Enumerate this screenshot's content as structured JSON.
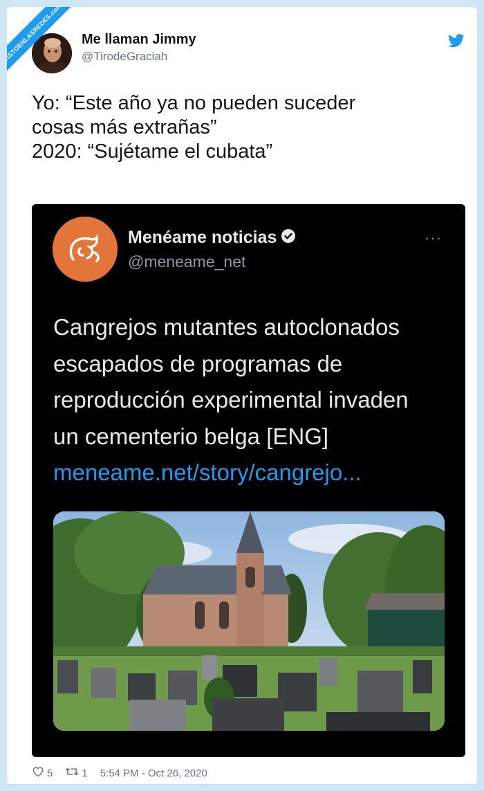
{
  "watermark": "VISTOENLASREDES.com",
  "tweet": {
    "author_name": "Me llaman Jimmy",
    "author_handle": "@TirodeGraciah",
    "text_lines": [
      "Yo: “Este año ya no pueden suceder",
      "cosas más extrañas”",
      "2020: “Sujétame el cubata”"
    ],
    "likes": "5",
    "retweets": "1",
    "timestamp": "5:54 PM - Oct 26, 2020"
  },
  "quoted": {
    "author_name": "Menéame noticias",
    "author_handle": "@meneame_net",
    "more_label": "···",
    "text_lines": [
      "Cangrejos mutantes autoclonados",
      "escapados de programas de",
      "reproducción experimental invaden",
      "un cementerio belga [ENG]"
    ],
    "link": "meneame.net/story/cangrejo..."
  },
  "colors": {
    "twitter_blue": "#1d9bf0",
    "meneame_orange": "#e3753a",
    "background": "#cfe6f7"
  },
  "icons": [
    "twitter-bird-icon",
    "verified-badge-icon",
    "heart-icon",
    "retweet-icon",
    "more-icon"
  ]
}
